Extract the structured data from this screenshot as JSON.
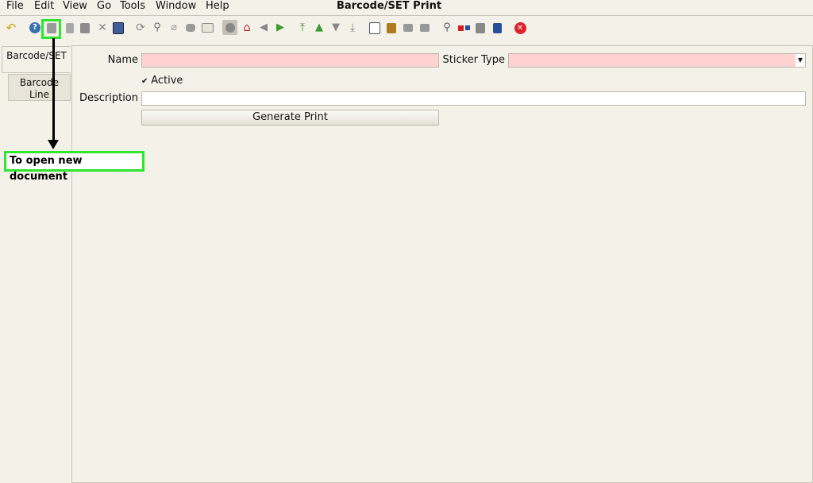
{
  "window": {
    "title": "Barcode/SET Print"
  },
  "menu": [
    {
      "label": "File"
    },
    {
      "label": "Edit"
    },
    {
      "label": "View"
    },
    {
      "label": "Go"
    },
    {
      "label": "Tools"
    },
    {
      "label": "Window"
    },
    {
      "label": "Help"
    }
  ],
  "toolbar": {
    "icons": [
      "undo-icon",
      "help-icon",
      "new-record-icon",
      "copy-record-icon",
      "delete-icon",
      "delete-selection-icon",
      "save-icon",
      "refresh-icon",
      "find-icon",
      "attachment-icon",
      "chat-icon",
      "history-icon",
      "grid-toggle-icon",
      "home-icon",
      "previous-icon",
      "next-icon",
      "first-record-icon",
      "previous-record-icon",
      "next-record-icon",
      "last-record-icon",
      "report-icon",
      "archive-icon",
      "print-preview-icon",
      "print-icon",
      "zoom-across-icon",
      "workflow-icon",
      "product-info-icon",
      "tasks-icon",
      "close-window-icon"
    ]
  },
  "tabs": [
    {
      "label": "Barcode/SET"
    },
    {
      "label": "Barcode Line"
    }
  ],
  "form": {
    "name_label": "Name",
    "name_value": "",
    "sticker_type_label": "Sticker Type",
    "sticker_type_value": "",
    "active_label": "Active",
    "active_checked": true,
    "description_label": "Description",
    "description_value": "",
    "generate_button": "Generate Print"
  },
  "annotation": {
    "text": "To open new document"
  },
  "colors": {
    "mandatory_field": "#ffd2d2",
    "highlight": "#2ee62e",
    "close": "#e0202a"
  }
}
